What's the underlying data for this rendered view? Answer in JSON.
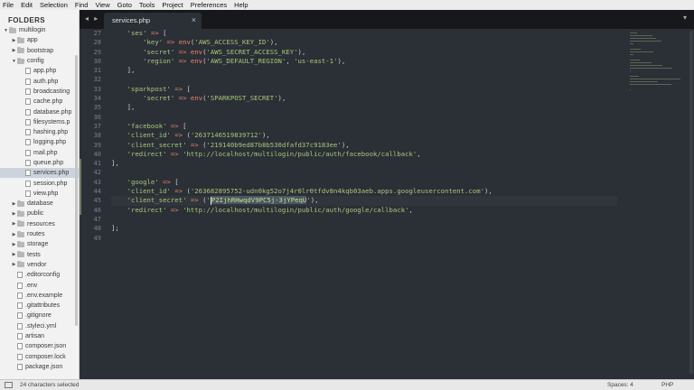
{
  "menu": [
    "File",
    "Edit",
    "Selection",
    "Find",
    "View",
    "Goto",
    "Tools",
    "Project",
    "Preferences",
    "Help"
  ],
  "sidebar": {
    "title": "FOLDERS",
    "tree": [
      {
        "label": "multilogin",
        "kind": "folder",
        "depth": 0,
        "open": true
      },
      {
        "label": "app",
        "kind": "folder",
        "depth": 1,
        "open": false
      },
      {
        "label": "bootstrap",
        "kind": "folder",
        "depth": 1,
        "open": false
      },
      {
        "label": "config",
        "kind": "folder",
        "depth": 1,
        "open": true
      },
      {
        "label": "app.php",
        "kind": "file",
        "depth": 2
      },
      {
        "label": "auth.php",
        "kind": "file",
        "depth": 2
      },
      {
        "label": "broadcasting",
        "kind": "file",
        "depth": 2
      },
      {
        "label": "cache.php",
        "kind": "file",
        "depth": 2
      },
      {
        "label": "database.php",
        "kind": "file",
        "depth": 2
      },
      {
        "label": "filesystems.p",
        "kind": "file",
        "depth": 2
      },
      {
        "label": "hashing.php",
        "kind": "file",
        "depth": 2
      },
      {
        "label": "logging.php",
        "kind": "file",
        "depth": 2
      },
      {
        "label": "mail.php",
        "kind": "file",
        "depth": 2
      },
      {
        "label": "queue.php",
        "kind": "file",
        "depth": 2
      },
      {
        "label": "services.php",
        "kind": "file",
        "depth": 2,
        "selected": true
      },
      {
        "label": "session.php",
        "kind": "file",
        "depth": 2
      },
      {
        "label": "view.php",
        "kind": "file",
        "depth": 2
      },
      {
        "label": "database",
        "kind": "folder",
        "depth": 1,
        "open": false
      },
      {
        "label": "public",
        "kind": "folder",
        "depth": 1,
        "open": false
      },
      {
        "label": "resources",
        "kind": "folder",
        "depth": 1,
        "open": false
      },
      {
        "label": "routes",
        "kind": "folder",
        "depth": 1,
        "open": false
      },
      {
        "label": "storage",
        "kind": "folder",
        "depth": 1,
        "open": false
      },
      {
        "label": "tests",
        "kind": "folder",
        "depth": 1,
        "open": false
      },
      {
        "label": "vendor",
        "kind": "folder",
        "depth": 1,
        "open": false
      },
      {
        "label": ".editorconfig",
        "kind": "file",
        "depth": 1
      },
      {
        "label": ".env",
        "kind": "file",
        "depth": 1
      },
      {
        "label": ".env.example",
        "kind": "file",
        "depth": 1
      },
      {
        "label": ".gitattributes",
        "kind": "file",
        "depth": 1
      },
      {
        "label": ".gitignore",
        "kind": "file",
        "depth": 1
      },
      {
        "label": ".styleci.yml",
        "kind": "file",
        "depth": 1
      },
      {
        "label": "artisan",
        "kind": "file",
        "depth": 1
      },
      {
        "label": "composer.json",
        "kind": "file",
        "depth": 1
      },
      {
        "label": "composer.lock",
        "kind": "file",
        "depth": 1
      },
      {
        "label": "package.json",
        "kind": "file",
        "depth": 1
      }
    ]
  },
  "tabs": {
    "nav": "◂ ▸",
    "active": "services.php",
    "close": "×",
    "dropdown": "▾"
  },
  "editor": {
    "lines": [
      {
        "n": "27",
        "t": [
          [
            "s",
            "    'ses'"
          ],
          [
            "o",
            " => "
          ],
          [
            "p",
            "["
          ]
        ]
      },
      {
        "n": "28",
        "t": [
          [
            "s",
            "        'key'"
          ],
          [
            "o",
            " => "
          ],
          [
            "f",
            "env"
          ],
          [
            "p",
            "("
          ],
          [
            "s",
            "'AWS_ACCESS_KEY_ID'"
          ],
          [
            "p",
            "),"
          ]
        ]
      },
      {
        "n": "29",
        "t": [
          [
            "s",
            "        'secret'"
          ],
          [
            "o",
            " => "
          ],
          [
            "f",
            "env"
          ],
          [
            "p",
            "("
          ],
          [
            "s",
            "'AWS_SECRET_ACCESS_KEY'"
          ],
          [
            "p",
            "),"
          ]
        ]
      },
      {
        "n": "30",
        "t": [
          [
            "s",
            "        'region'"
          ],
          [
            "o",
            " => "
          ],
          [
            "f",
            "env"
          ],
          [
            "p",
            "("
          ],
          [
            "s",
            "'AWS_DEFAULT_REGION'"
          ],
          [
            "p",
            ", "
          ],
          [
            "s",
            "'us-east-1'"
          ],
          [
            "p",
            "),"
          ]
        ]
      },
      {
        "n": "31",
        "t": [
          [
            "p",
            "    ],"
          ]
        ]
      },
      {
        "n": "32",
        "t": []
      },
      {
        "n": "33",
        "t": [
          [
            "s",
            "    'sparkpost'"
          ],
          [
            "o",
            " => "
          ],
          [
            "p",
            "["
          ]
        ]
      },
      {
        "n": "34",
        "t": [
          [
            "s",
            "        'secret'"
          ],
          [
            "o",
            " => "
          ],
          [
            "f",
            "env"
          ],
          [
            "p",
            "("
          ],
          [
            "s",
            "'SPARKPOST_SECRET'"
          ],
          [
            "p",
            "),"
          ]
        ]
      },
      {
        "n": "35",
        "t": [
          [
            "p",
            "    ],"
          ]
        ]
      },
      {
        "n": "36",
        "t": []
      },
      {
        "n": "37",
        "t": [
          [
            "s",
            "    'facebook'"
          ],
          [
            "o",
            " => "
          ],
          [
            "p",
            "["
          ]
        ]
      },
      {
        "n": "38",
        "t": [
          [
            "s",
            "    'client_id'"
          ],
          [
            "o",
            " => "
          ],
          [
            "p",
            "("
          ],
          [
            "s",
            "'2637146519839712'"
          ],
          [
            "p",
            "),"
          ]
        ]
      },
      {
        "n": "39",
        "t": [
          [
            "s",
            "    'client_secret'"
          ],
          [
            "o",
            " => "
          ],
          [
            "p",
            "("
          ],
          [
            "s",
            "'219140b9ed87b8b530dfafd37c9183ee'"
          ],
          [
            "p",
            "),"
          ]
        ]
      },
      {
        "n": "40",
        "t": [
          [
            "s",
            "    'redirect'"
          ],
          [
            "o",
            " => "
          ],
          [
            "s",
            "'http://localhost/multilogin/public/auth/facebook/callback'"
          ],
          [
            "p",
            ","
          ]
        ]
      },
      {
        "n": "41",
        "t": [
          [
            "p",
            "],"
          ]
        ]
      },
      {
        "n": "42",
        "t": []
      },
      {
        "n": "43",
        "t": [
          [
            "s",
            "    'google'"
          ],
          [
            "o",
            " => "
          ],
          [
            "p",
            "["
          ]
        ]
      },
      {
        "n": "44",
        "t": [
          [
            "s",
            "    'client_id'"
          ],
          [
            "o",
            " => "
          ],
          [
            "p",
            "("
          ],
          [
            "s",
            "'263682895752-udn0kg52o7j4r0lr0tfdv8n4kqb03aeb.apps.googleusercontent.com'"
          ],
          [
            "p",
            "),"
          ]
        ]
      },
      {
        "n": "45",
        "t": [
          [
            "s",
            "    'client_secret'"
          ],
          [
            "o",
            " => "
          ],
          [
            "p",
            "("
          ],
          [
            "s",
            "'"
          ],
          [
            "caret",
            ""
          ],
          [
            "sel",
            "P2IjhRHwqdV9PC5j-3jYPeqU"
          ],
          [
            "s",
            "'"
          ],
          [
            "p",
            "),"
          ]
        ],
        "highlight": true
      },
      {
        "n": "46",
        "t": [
          [
            "s",
            "    'redirect'"
          ],
          [
            "o",
            " => "
          ],
          [
            "s",
            "'http://localhost/multilogin/public/auth/google/callback'"
          ],
          [
            "p",
            ","
          ]
        ]
      },
      {
        "n": "47",
        "t": []
      },
      {
        "n": "48",
        "t": [
          [
            "p",
            "];"
          ]
        ]
      },
      {
        "n": "49",
        "t": []
      }
    ],
    "modified_lines": [
      "41",
      "42",
      "43",
      "44",
      "45",
      "46"
    ]
  },
  "status": {
    "selection": "24 characters selected",
    "spaces": "Spaces: 4",
    "syntax": "PHP"
  },
  "colors": {
    "background": "#2b2f36",
    "string": "#a9c77b",
    "operator": "#e8866a",
    "sidebar_bg": "#f2f2f2"
  }
}
